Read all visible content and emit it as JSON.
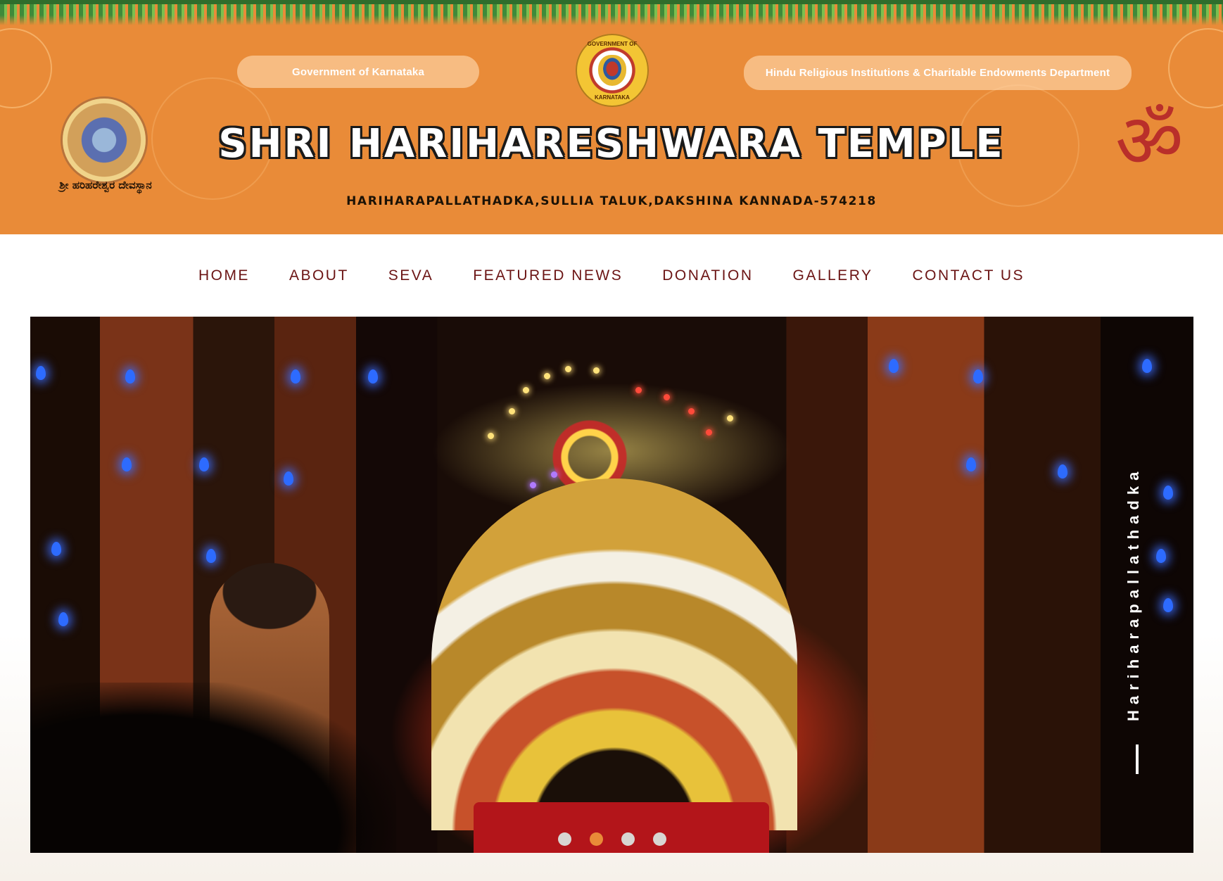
{
  "header": {
    "gov_pill": "Government of Karnataka",
    "dept_pill": "Hindu Religious Institutions &  Charitable Endowments Department",
    "seal_top": "GOVERNMENT OF",
    "seal_bottom": "KARNATAKA",
    "deity_caption": "ಶ್ರೀ ಹರಿಹರೇಶ್ವರ ದೇವಸ್ಥಾನ",
    "om_symbol": "ॐ",
    "title": "SHRI HARIHARESHWARA TEMPLE",
    "address": "HARIHARAPALLATHADKA,SULLIA TALUK,DAKSHINA KANNADA-574218"
  },
  "nav": {
    "items": [
      "HOME",
      "ABOUT",
      "SEVA",
      "FEATURED NEWS",
      "DONATION",
      "GALLERY",
      "CONTACT US"
    ]
  },
  "hero": {
    "vertical_text": "Hariharapallathadka",
    "slides": 4,
    "active_slide": 2
  },
  "colors": {
    "header_bg": "#e98b38",
    "nav_text": "#6b1414",
    "om": "#b92f2a",
    "dot_active": "#e98b38",
    "dot_inactive": "#d8d6d2"
  }
}
